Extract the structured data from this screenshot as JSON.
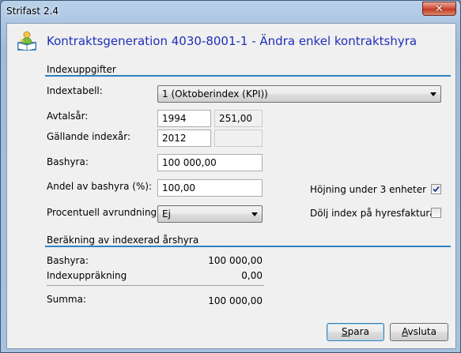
{
  "window": {
    "title": "Strifast 2.4",
    "close_symbol": "✕"
  },
  "header": {
    "title": "Kontraktsgeneration 4030-8001-1 - Ändra enkel kontraktshyra",
    "icon": "reading-person-icon"
  },
  "index_section": {
    "title": "Indexuppgifter",
    "indextabell": {
      "label": "Indextabell:",
      "value": "1 (Oktoberindex (KPI))"
    },
    "avtalsar": {
      "label": "Avtalsår:",
      "value": "1994",
      "index_value": "251,00"
    },
    "gallande_indexar": {
      "label": "Gällande indexår:",
      "value": "2012",
      "index_value": ""
    },
    "bashyra": {
      "label": "Bashyra:",
      "value": "100 000,00"
    },
    "andel": {
      "label": "Andel av bashyra (%):",
      "value": "100,00"
    },
    "avrundning": {
      "label": "Procentuell avrundning:",
      "value": "Ej"
    },
    "hojning": {
      "label": "Höjning under 3 enheter",
      "checked": true
    },
    "dolj_index": {
      "label": "Dölj index på hyresfaktura",
      "checked": false
    }
  },
  "calc_section": {
    "title": "Beräkning av indexerad årshyra",
    "rows": [
      {
        "label": "Bashyra:",
        "value": "100 000,00"
      },
      {
        "label": "Indexuppräkning",
        "value": "0,00"
      }
    ],
    "sum": {
      "label": "Summa:",
      "value": "100 000,00"
    }
  },
  "buttons": {
    "save": {
      "mnemonic": "S",
      "rest": "para"
    },
    "cancel": {
      "mnemonic": "A",
      "rest": "vsluta"
    }
  }
}
